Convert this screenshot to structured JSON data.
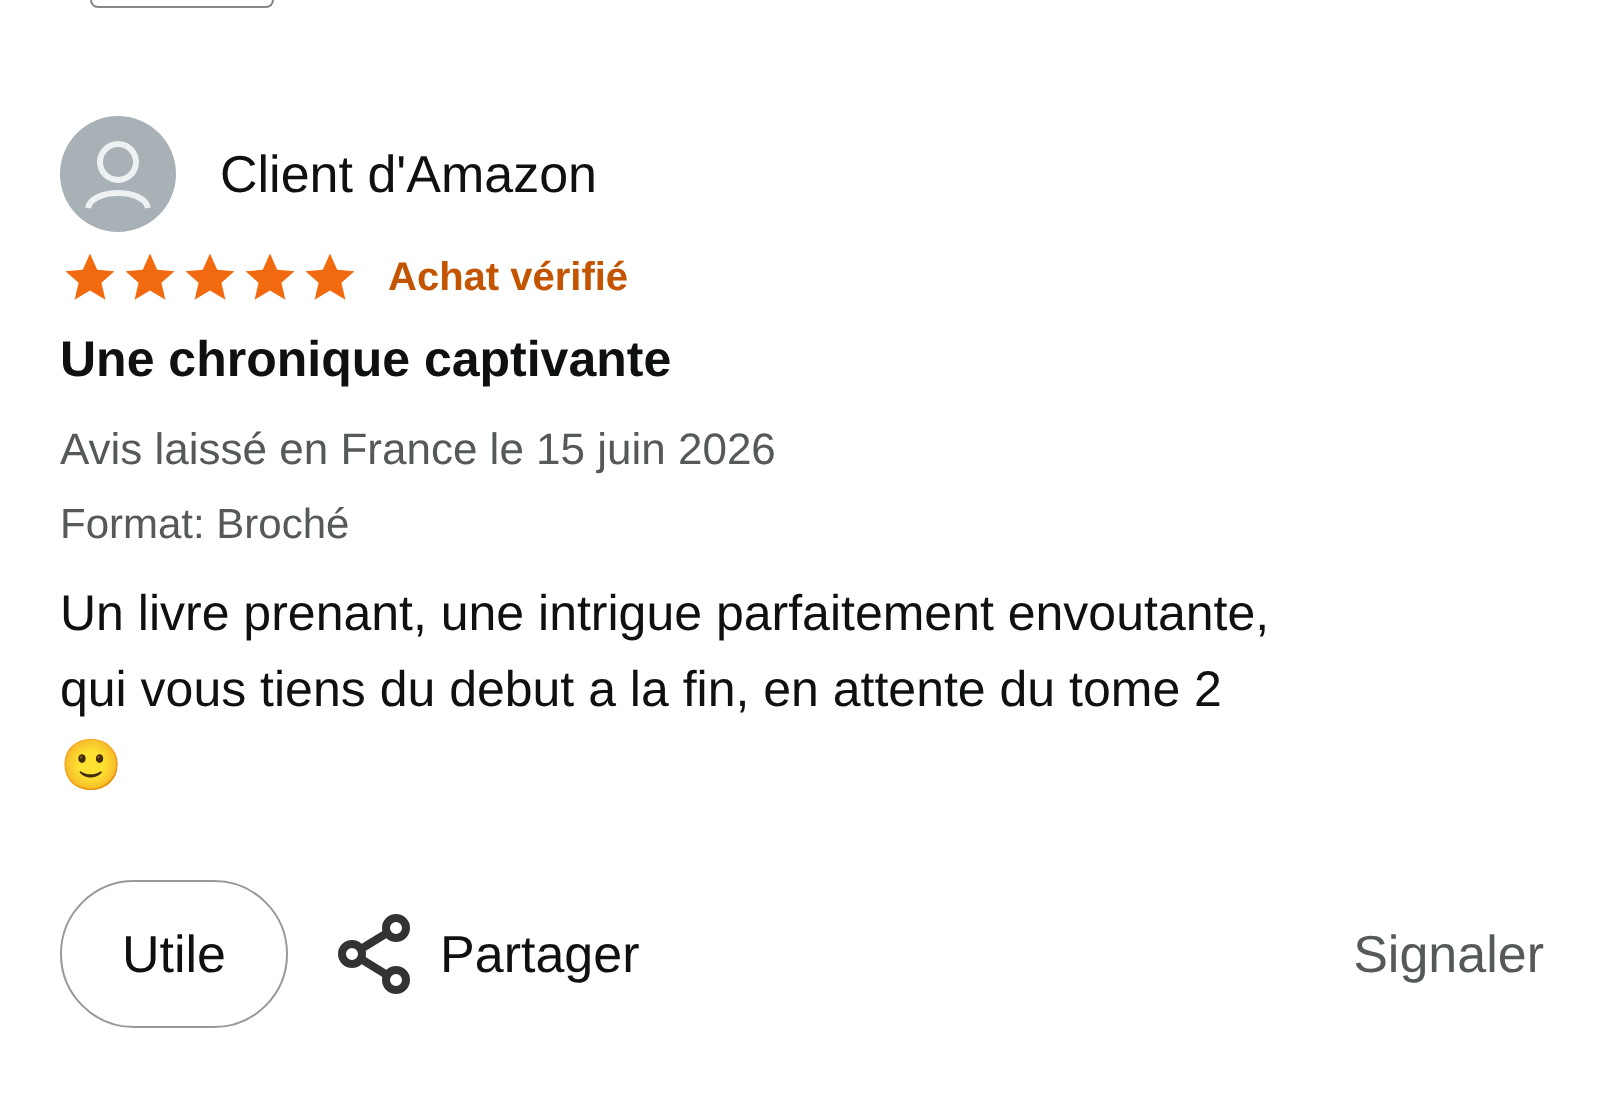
{
  "review": {
    "author": "Client d'Amazon",
    "stars": 5,
    "verified": "Achat vérifié",
    "title": "Une chronique captivante",
    "meta": "Avis laissé en France le 15 juin 2026",
    "format": "Format: Broché",
    "body": "Un livre prenant, une intrigue parfaitement envoutante, qui vous tiens du debut a la fin, en attente du tome 2 🙂"
  },
  "actions": {
    "helpful": "Utile",
    "share": "Partager",
    "report": "Signaler"
  }
}
